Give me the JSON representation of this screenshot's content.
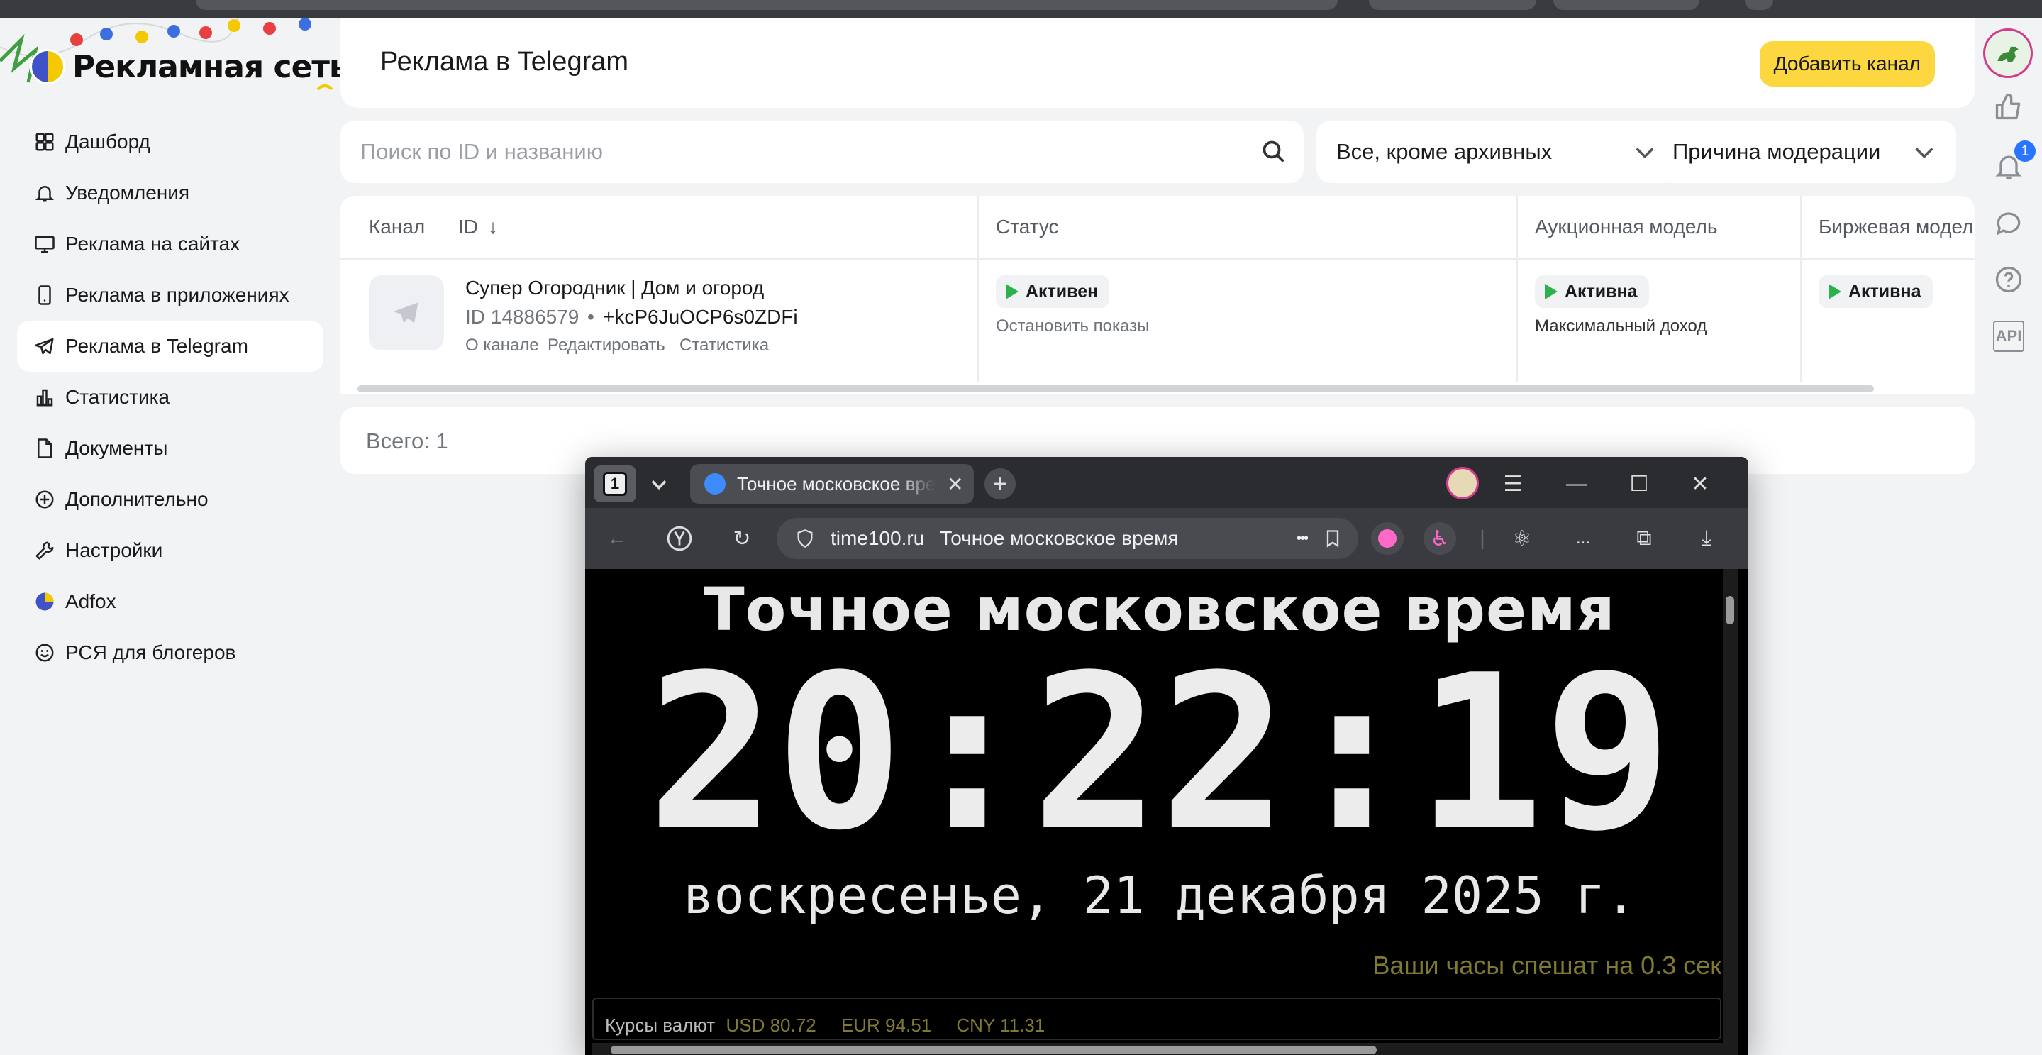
{
  "app": {
    "logo_text": "Рекламная сеть",
    "page_title": "Реклама в Telegram",
    "add_button": "Добавить канал"
  },
  "sidebar": {
    "items": [
      {
        "label": "Дашборд",
        "icon": "dashboard-icon"
      },
      {
        "label": "Уведомления",
        "icon": "bell-icon"
      },
      {
        "label": "Реклама на сайтах",
        "icon": "monitor-icon"
      },
      {
        "label": "Реклама в приложениях",
        "icon": "phone-icon"
      },
      {
        "label": "Реклама в Telegram",
        "icon": "telegram-icon",
        "active": true
      },
      {
        "label": "Статистика",
        "icon": "chart-icon"
      },
      {
        "label": "Документы",
        "icon": "document-icon"
      },
      {
        "label": "Дополнительно",
        "icon": "plus-circle-icon"
      },
      {
        "label": "Настройки",
        "icon": "wrench-icon"
      },
      {
        "label": "Adfox",
        "icon": "adfox-icon"
      },
      {
        "label": "РСЯ для блогеров",
        "icon": "smile-icon"
      }
    ]
  },
  "filters": {
    "search_placeholder": "Поиск по ID и названию",
    "status_select": "Все, кроме архивных",
    "moderation_select": "Причина модерации"
  },
  "table": {
    "headers": {
      "channel": "Канал",
      "id": "ID",
      "id_sort": "↓",
      "status": "Статус",
      "auction": "Аукционная модель",
      "exchange": "Биржевая модел"
    },
    "row": {
      "name": "Супер Огородник | Дом и огород",
      "id": "ID 14886579",
      "separator": "•",
      "invite": "+kcP6JuOCP6s0ZDFi",
      "link_about": "О канале",
      "link_edit": "Редактировать",
      "link_stats": "Статистика",
      "status_badge": "Активен",
      "status_action": "Остановить показы",
      "auction_badge": "Активна",
      "auction_note": "Максимальный доход",
      "exchange_badge": "Активна"
    }
  },
  "total": "Всего: 1",
  "rail": {
    "notification_count": "1",
    "api_label": "API"
  },
  "browser": {
    "tab_count": "1",
    "tab_title": "Точное московское время",
    "tab_close": "✕",
    "new_tab": "+",
    "address_domain": "time100.ru",
    "address_title": "Точное московское время",
    "more_dots": "•••",
    "menu_ellipsis": "..."
  },
  "clock_page": {
    "heading": "Точное московское время",
    "time": "20:22:19",
    "date": "воскресенье, 21 декабря 2025 г.",
    "offset_note": "Ваши часы спешат на 0.3 сек",
    "rates_label": "Курсы валют",
    "rates": [
      {
        "code": "USD",
        "value": "80.72"
      },
      {
        "code": "EUR",
        "value": "94.51"
      },
      {
        "code": "CNY",
        "value": "11.31"
      }
    ]
  },
  "colors": {
    "accent_yellow": "#fcd740",
    "status_green": "#2bb24c",
    "offset_olive": "#7f7a30"
  }
}
